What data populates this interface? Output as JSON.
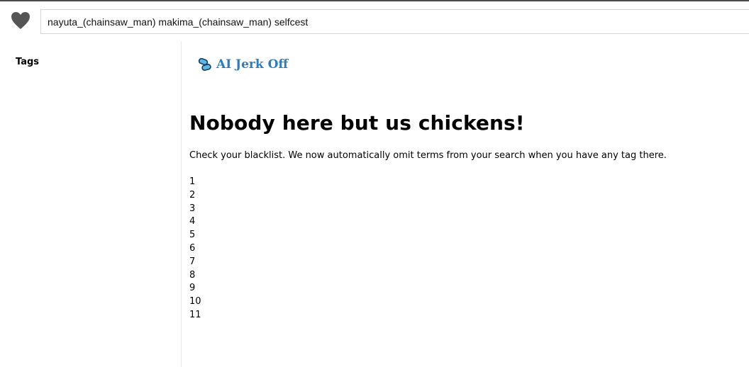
{
  "search": {
    "query": "nayuta_(chainsaw_man) makima_(chainsaw_man) selfcest"
  },
  "sidebar": {
    "title": "Tags"
  },
  "main": {
    "ad_label": "AI Jerk Off",
    "heading": "Nobody here but us chickens!",
    "message": "Check your blacklist. We now automatically omit terms from your search when you have any tag there.",
    "pages": [
      "1",
      "2",
      "3",
      "4",
      "5",
      "6",
      "7",
      "8",
      "9",
      "10",
      "11"
    ]
  },
  "icons": {
    "favorite": "heart-icon",
    "ad": "pills-icon"
  },
  "colors": {
    "link": "#2b7cc0",
    "heart": "#555555",
    "pill_fill": "#5bb8e8",
    "pill_stroke": "#1a3c5a"
  }
}
